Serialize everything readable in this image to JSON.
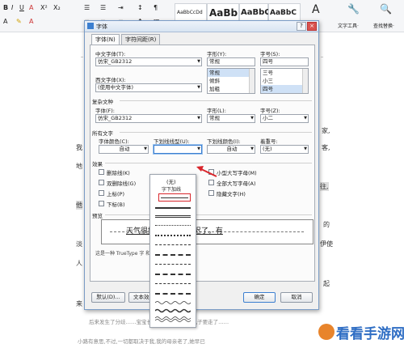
{
  "ribbon": {
    "styles": [
      "AaBbCcDd",
      "AaBb",
      "AaBbC",
      "AaBbC"
    ],
    "icons": [
      "text-style-icon",
      "tools-icon",
      "find-replace-icon"
    ],
    "text_tool_label": "文字工具·",
    "find_replace_label": "查找替换·"
  },
  "document": {
    "lines": [
      "家,",
      "我",
      "客,",
      "地",
      "往,",
      "他",
      "的",
      "淡",
      "伊使",
      "人",
      "起",
      "来",
      "后来发生了分歧……宝宝长大,大哥平稳,我的儿子要走了……",
      "小路有意思,不过,一切都取决于我,我的母亲老了,她早已"
    ]
  },
  "dialog": {
    "title": "字体",
    "close_label": "×",
    "help_label": "?",
    "tabs": [
      "字体(N)",
      "字符间距(R)"
    ],
    "chinese_font": {
      "label": "中文字体(T):",
      "value": "仿宋_GB2312"
    },
    "style": {
      "label": "字形(Y):",
      "value": "常规",
      "options": [
        "常规",
        "倾斜",
        "加粗"
      ]
    },
    "size": {
      "label": "字号(S):",
      "value": "四号",
      "options": [
        "三号",
        "小三",
        "四号"
      ]
    },
    "western_font": {
      "label": "西文字体(X):",
      "value": "(使用中文字体)"
    },
    "complex": {
      "section": "复杂文种",
      "font": {
        "label": "字体(F):",
        "value": "仿宋_GB2312"
      },
      "style": {
        "label": "字形(L):",
        "value": "常规"
      },
      "size": {
        "label": "字号(Z):",
        "value": "小二"
      }
    },
    "all_text": {
      "section": "所有文字",
      "font_color": {
        "label": "字体颜色(C):",
        "value": "自动"
      },
      "underline_type": {
        "label": "下划线线型(U):",
        "value": ""
      },
      "underline_color": {
        "label": "下划线颜色(I):",
        "value": "自动"
      },
      "emphasis": {
        "label": "着重号:",
        "value": "(无)"
      }
    },
    "effects": {
      "section": "效果",
      "left": [
        "删除线(K)",
        "双删除线(G)",
        "上标(P)",
        "下标(B)"
      ],
      "right": [
        "小型大写字母(M)",
        "全部大写字母(A)",
        "隐藏文字(H)"
      ]
    },
    "preview": {
      "section": "预览",
      "text": "天气很好来的太迟,太迟了。有",
      "note": "这是一种 TrueType 字                    和打印机。"
    },
    "buttons": {
      "default": "默认(D)...",
      "text_effects": "文本效果",
      "ok": "确定",
      "cancel": "取消"
    }
  },
  "underline_dropdown": {
    "none_label": "(无)",
    "words_only_label": "字下加线",
    "styles": [
      "single-selected",
      "thick",
      "double",
      "dotted",
      "dashed",
      "dash-long",
      "dash-dot",
      "dash-dot-dot",
      "heavy-dash",
      "wavy",
      "double-wavy",
      "heavy-wavy"
    ]
  },
  "watermark": "看看手游网",
  "colors": {
    "accent": "#3c7fd0",
    "selection": "#cfe1f6",
    "annotation_red": "#d9262c"
  }
}
